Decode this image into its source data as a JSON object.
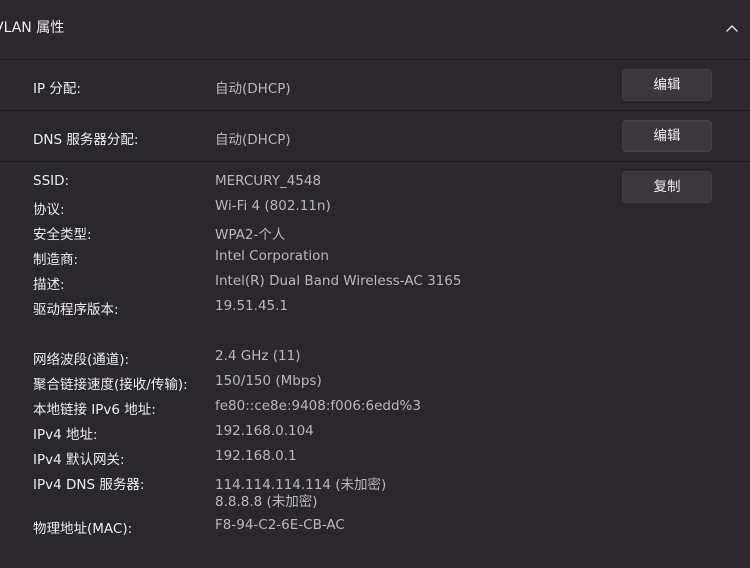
{
  "header": {
    "title": "VLAN 属性"
  },
  "ip_assignment": {
    "label": "IP 分配:",
    "value": "自动(DHCP)",
    "button": "编辑"
  },
  "dns_assignment": {
    "label": "DNS 服务器分配:",
    "value": "自动(DHCP)",
    "button": "编辑"
  },
  "details": {
    "copy_button": "复制",
    "props": [
      {
        "label": "SSID:",
        "value": "MERCURY_4548"
      },
      {
        "label": "协议:",
        "value": "Wi-Fi 4 (802.11n)"
      },
      {
        "label": "安全类型:",
        "value": "WPA2-个人"
      },
      {
        "label": "制造商:",
        "value": "Intel Corporation"
      },
      {
        "label": "描述:",
        "value": "Intel(R) Dual Band Wireless-AC 3165"
      },
      {
        "label": "驱动程序版本:",
        "value": "19.51.45.1"
      },
      {
        "label": "网络波段(通道):",
        "value": "2.4 GHz (11)"
      },
      {
        "label": "聚合链接速度(接收/传输):",
        "value": "150/150 (Mbps)"
      },
      {
        "label": "本地链接 IPv6 地址:",
        "value": "fe80::ce8e:9408:f006:6edd%3"
      },
      {
        "label": "IPv4 地址:",
        "value": "192.168.0.104"
      },
      {
        "label": "IPv4 默认网关:",
        "value": "192.168.0.1"
      },
      {
        "label": "IPv4 DNS 服务器:",
        "value": "114.114.114.114 (未加密)",
        "value2": "8.8.8.8 (未加密)"
      },
      {
        "label": "物理地址(MAC):",
        "value": "F8-94-C2-6E-CB-AC"
      }
    ]
  }
}
